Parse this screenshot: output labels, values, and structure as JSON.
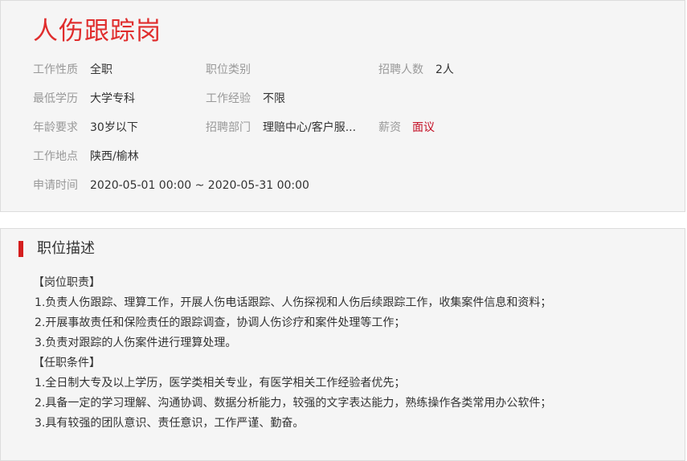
{
  "job": {
    "title": "人伤跟踪岗"
  },
  "info": {
    "nature_label": "工作性质",
    "nature_value": "全职",
    "category_label": "职位类别",
    "category_value": "",
    "headcount_label": "招聘人数",
    "headcount_value": "2人",
    "education_label": "最低学历",
    "education_value": "大学专科",
    "experience_label": "工作经验",
    "experience_value": "不限",
    "age_label": "年龄要求",
    "age_value": "30岁以下",
    "department_label": "招聘部门",
    "department_value": "理赔中心/客户服...",
    "salary_label": "薪资",
    "salary_value": "面议",
    "location_label": "工作地点",
    "location_value": "陕西/榆林",
    "apply_time_label": "申请时间",
    "apply_time_value": "2020-05-01 00:00 ~ 2020-05-31 00:00"
  },
  "description": {
    "section_title": "职位描述",
    "lines": [
      "【岗位职责】",
      "1.负责人伤跟踪、理算工作，开展人伤电话跟踪、人伤探视和人伤后续跟踪工作，收集案件信息和资料；",
      "2.开展事故责任和保险责任的跟踪调查，协调人伤诊疗和案件处理等工作；",
      "3.负责对跟踪的人伤案件进行理算处理。",
      "【任职条件】",
      "1.全日制大专及以上学历，医学类相关专业，有医学相关工作经验者优先；",
      "2.具备一定的学习理解、沟通协调、数据分析能力，较强的文字表达能力，熟练操作各类常用办公软件；",
      "3.具有较强的团队意识、责任意识，工作严谨、勤奋。"
    ]
  },
  "colors": {
    "title_red": "#e02d2d",
    "salary_red": "#c30d23",
    "section_bar": "#d41e1e",
    "label_gray": "#999999",
    "card_bg": "#f5f5f5"
  }
}
